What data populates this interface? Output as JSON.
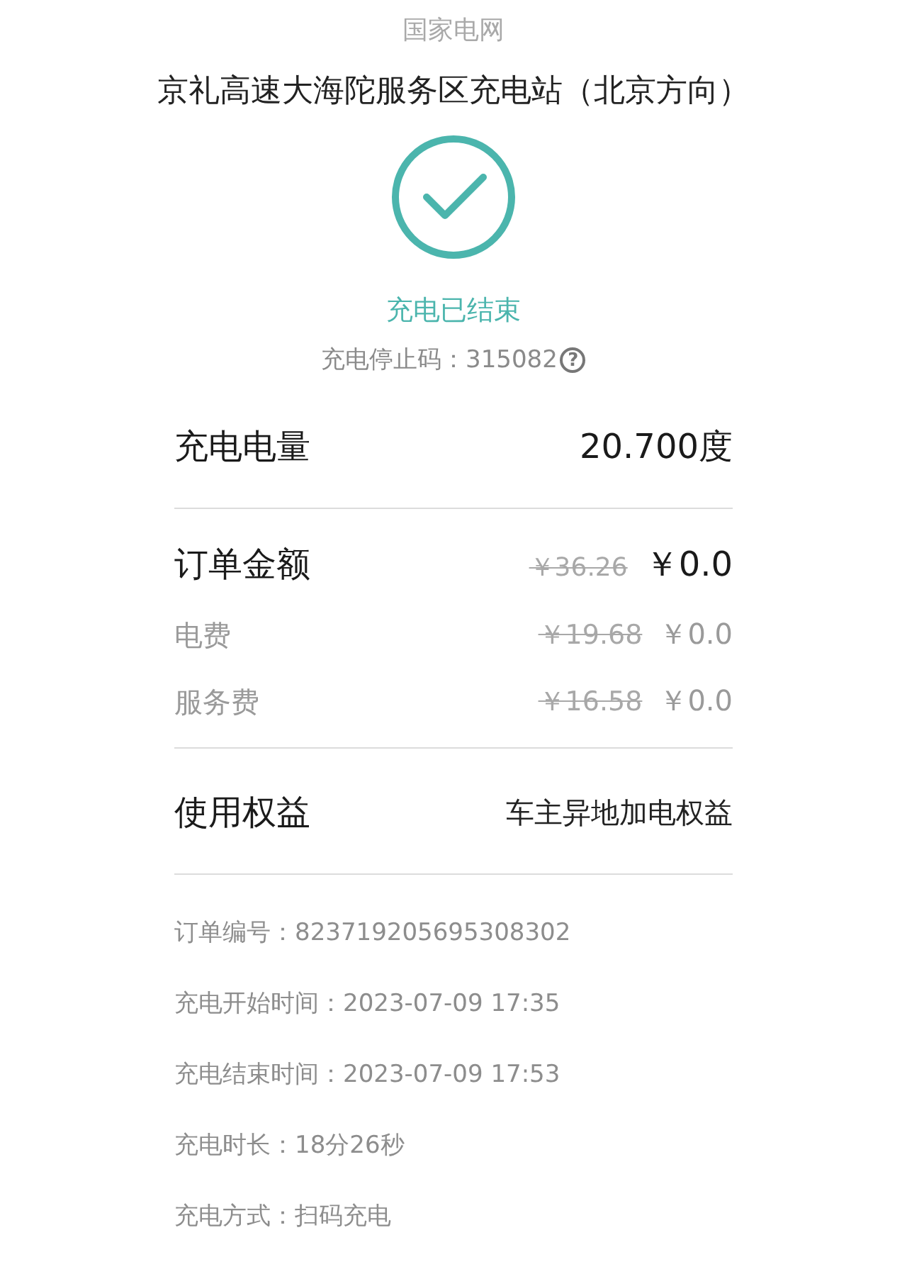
{
  "header": {
    "title": "国家电网"
  },
  "station": {
    "name": "京礼高速大海陀服务区充电站（北京方向）"
  },
  "status": {
    "text": "充电已结束",
    "stop_code_label": "充电停止码：",
    "stop_code": "315082",
    "help_icon": "?"
  },
  "energy": {
    "label": "充电电量",
    "value": "20.700度"
  },
  "order_amount": {
    "label": "订单金额",
    "original": "￥36.26",
    "price": "￥0.0"
  },
  "fees": [
    {
      "label": "电费",
      "original": "￥19.68",
      "price": "￥0.0"
    },
    {
      "label": "服务费",
      "original": "￥16.58",
      "price": "￥0.0"
    }
  ],
  "benefit": {
    "label": "使用权益",
    "value": "车主异地加电权益"
  },
  "details": [
    {
      "label": "订单编号：",
      "value": "823719205695308302"
    },
    {
      "label": "充电开始时间：",
      "value": "2023-07-09  17:35"
    },
    {
      "label": "充电结束时间：",
      "value": "2023-07-09  17:53"
    },
    {
      "label": "充电时长：",
      "value": "18分26秒"
    },
    {
      "label": "充电方式：",
      "value": "扫码充电"
    }
  ]
}
